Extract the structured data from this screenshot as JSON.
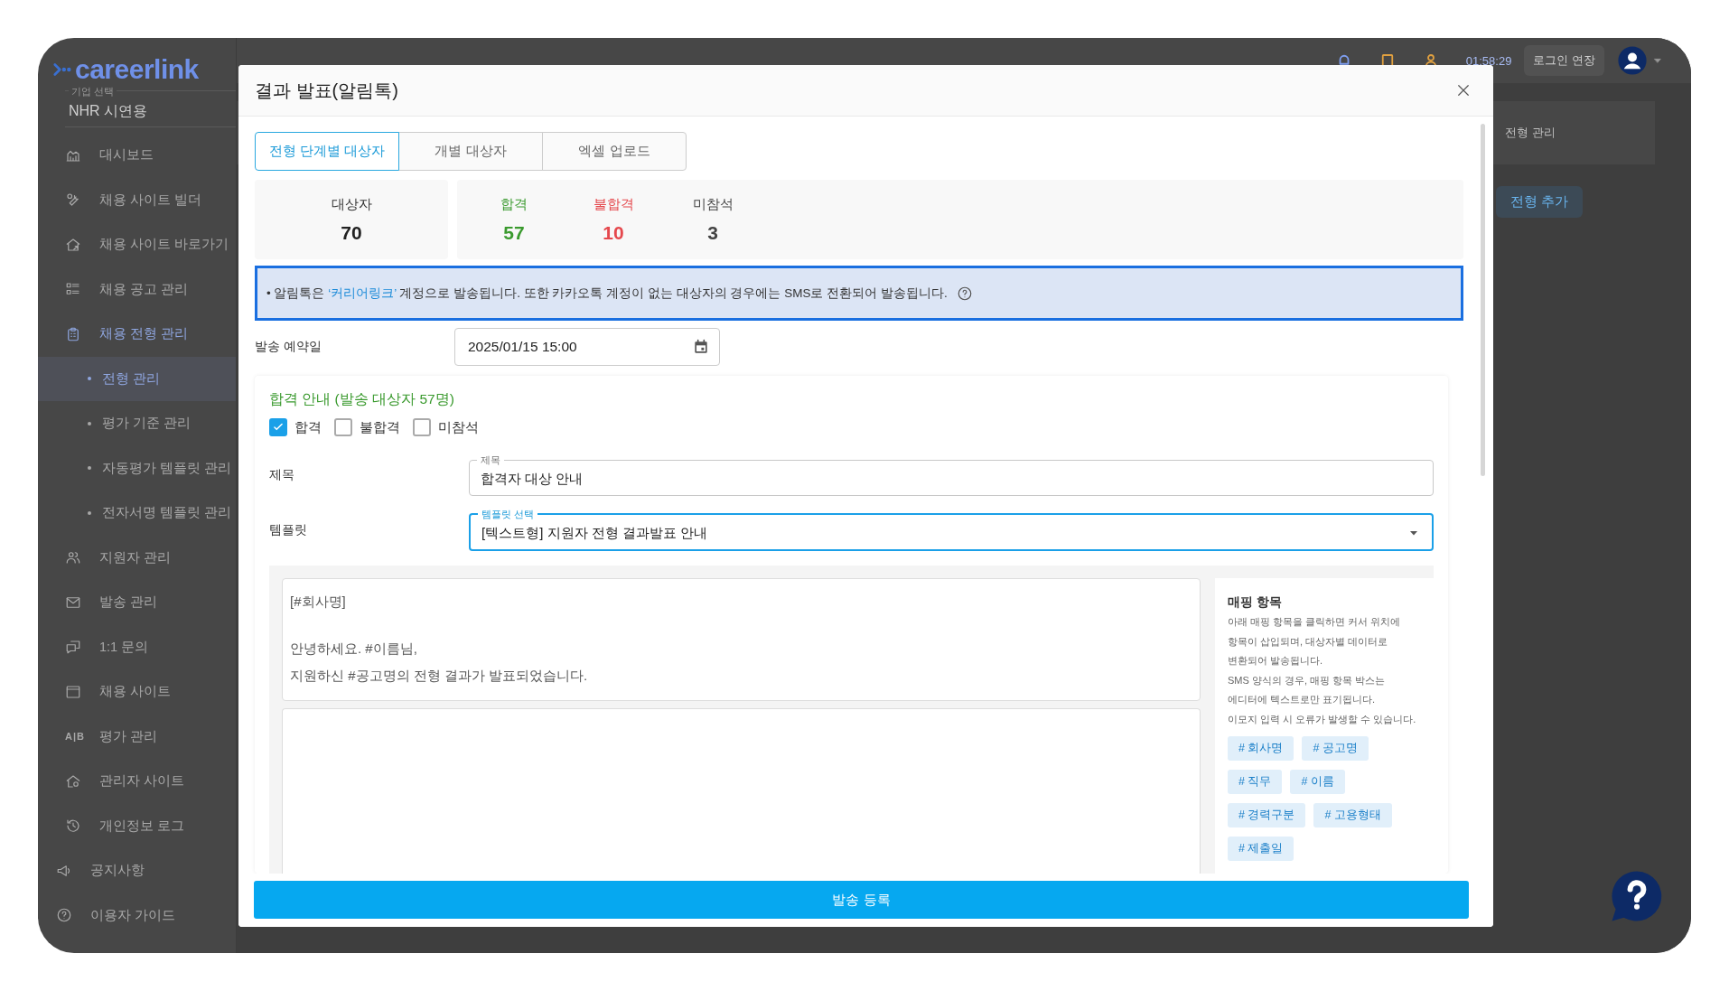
{
  "app": {
    "logo": "careerlink",
    "company_label": "기업 선택",
    "company": "NHR 시연용"
  },
  "sidebar": {
    "items": [
      {
        "label": "대시보드",
        "selected": false
      },
      {
        "label": "채용 사이트 빌더",
        "selected": false
      },
      {
        "label": "채용 사이트 바로가기",
        "selected": false
      },
      {
        "label": "채용 공고 관리",
        "selected": false
      },
      {
        "label": "채용 전형 관리",
        "selected": true,
        "children": [
          {
            "label": "전형 관리",
            "selected": true
          },
          {
            "label": "평가 기준 관리",
            "selected": false
          },
          {
            "label": "자동평가 템플릿 관리",
            "selected": false
          },
          {
            "label": "전자서명 템플릿 관리",
            "selected": false
          }
        ]
      },
      {
        "label": "지원자 관리",
        "selected": false
      },
      {
        "label": "발송 관리",
        "selected": false
      },
      {
        "label": "1:1 문의",
        "selected": false
      },
      {
        "label": "채용 사이트",
        "selected": false
      },
      {
        "label": "평가 관리",
        "selected": false,
        "icon_text": "A|B"
      },
      {
        "label": "관리자 사이트",
        "selected": false
      },
      {
        "label": "개인정보 로그",
        "selected": false
      },
      {
        "label": "공지사항",
        "selected": false
      },
      {
        "label": "이용자 가이드",
        "selected": false
      }
    ]
  },
  "header": {
    "timer": "01:58:29",
    "extend_button": "로그인 연장"
  },
  "breadcrumb": "전형 관리",
  "add_stage_button": "전형 추가",
  "modal": {
    "title": "결과 발표(알림톡)",
    "tabs": [
      {
        "label": "전형 단계별 대상자",
        "selected": true
      },
      {
        "label": "개별 대상자",
        "selected": false
      },
      {
        "label": "엑셀 업로드",
        "selected": false
      }
    ],
    "total": {
      "label": "대상자",
      "value": "70"
    },
    "stats": [
      {
        "label": "합격",
        "value": "57",
        "color": "#3a9a2e"
      },
      {
        "label": "불합격",
        "value": "10",
        "color": "#e5484d"
      },
      {
        "label": "미참석",
        "value": "3",
        "color": "#444444"
      }
    ],
    "notice": {
      "before": "• 알림톡은 ",
      "highlight": "‘커리어링크’",
      "after": " 계정으로 발송됩니다. 또한 카카오톡 계정이 없는 대상자의 경우에는 SMS로 전환되어 발송됩니다."
    },
    "schedule": {
      "label": "발송 예약일",
      "value": "2025/01/15 15:00"
    },
    "section": {
      "title": "합격 안내 (발송 대상자 57명)",
      "filters": [
        {
          "label": "합격",
          "checked": true
        },
        {
          "label": "불합격",
          "checked": false
        },
        {
          "label": "미참석",
          "checked": false
        }
      ],
      "subject": {
        "label": "제목",
        "field_label": "제목",
        "value": "합격자 대상 안내"
      },
      "template": {
        "label": "템플릿",
        "field_label": "템플릿 선택",
        "value": "[텍스트형] 지원자 전형 결과발표 안내"
      },
      "message": [
        [
          "[#회사명]"
        ],
        [
          "안녕하세요. #이름님,",
          "지원하신 #공고명의 전형 결과가 발표되었습니다."
        ]
      ],
      "mapping": {
        "title": "매핑 항목",
        "description": "아래 매핑 항목을 클릭하면 커서 위치에\n항목이 삽입되며, 대상자별 데이터로\n변환되어 발송됩니다.\nSMS 양식의 경우, 매핑 항목 박스는\n에디터에 텍스트로만 표기됩니다.\n이모지 입력 시 오류가 발생할 수 있습니다.",
        "tags": [
          "# 회사명",
          "# 공고명",
          "# 직무",
          "# 이름",
          "# 경력구분",
          "# 고용형태",
          "# 제출일"
        ]
      }
    },
    "submit_button": "발송 등록"
  }
}
